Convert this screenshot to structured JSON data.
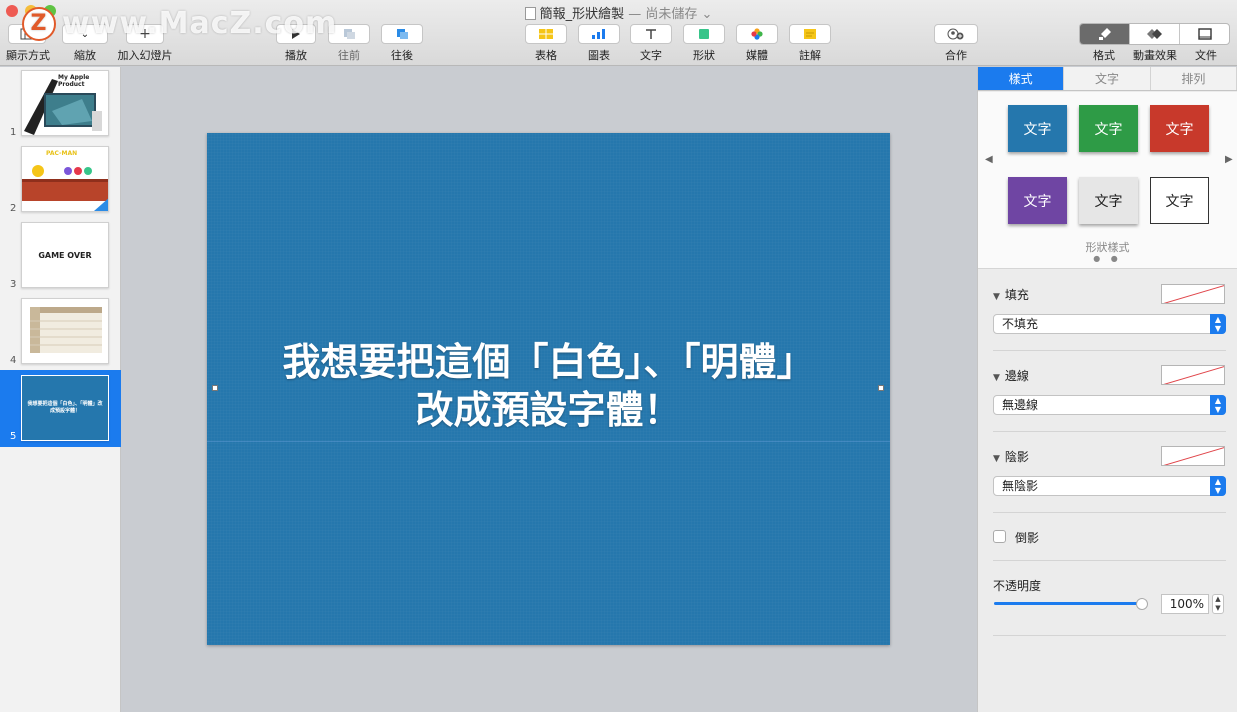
{
  "window": {
    "title": "簡報_形狀繪製",
    "title_separator": "—",
    "title_status": "尚未儲存",
    "watermark": "www.MacZ.com"
  },
  "toolbar": {
    "view_label": "顯示方式",
    "zoom_label": "縮放",
    "add_slide_label": "加入幻燈片",
    "play_label": "播放",
    "forward_label": "往前",
    "backward_label": "往後",
    "table_label": "表格",
    "chart_label": "圖表",
    "text_label": "文字",
    "shape_label": "形狀",
    "media_label": "媒體",
    "comment_label": "註解",
    "collaborate_label": "合作",
    "format_label": "格式",
    "animate_label": "動畫效果",
    "document_label": "文件"
  },
  "navigator": {
    "slides": [
      {
        "number": "1",
        "caption": "My Apple Product"
      },
      {
        "number": "2",
        "caption": "PAC-MAN"
      },
      {
        "number": "3",
        "caption": "GAME OVER"
      },
      {
        "number": "4",
        "caption": ""
      },
      {
        "number": "5",
        "caption": "我想要把這個「白色」、「明體」改成預設字體！"
      }
    ]
  },
  "slide": {
    "line1": "我想要把這個「白色」、「明體」",
    "line2": "改成預設字體！"
  },
  "inspector": {
    "tabs": [
      "樣式",
      "文字",
      "排列"
    ],
    "style_presets": [
      {
        "label": "文字",
        "bg": "#2577ad",
        "fg": "#ffffff"
      },
      {
        "label": "文字",
        "bg": "#2e9b46",
        "fg": "#ffffff"
      },
      {
        "label": "文字",
        "bg": "#c8392b",
        "fg": "#ffffff"
      },
      {
        "label": "文字",
        "bg": "#6f45a3",
        "fg": "#ffffff"
      },
      {
        "label": "文字",
        "bg": "#e6e6e6",
        "fg": "#222222"
      },
      {
        "label": "文字",
        "bg": "#ffffff",
        "fg": "#222222"
      }
    ],
    "styles_caption": "形狀樣式",
    "fill": {
      "title": "填充",
      "value": "不填充"
    },
    "border": {
      "title": "邊線",
      "value": "無邊線"
    },
    "shadow": {
      "title": "陰影",
      "value": "無陰影"
    },
    "reflection": {
      "title": "倒影"
    },
    "opacity": {
      "title": "不透明度",
      "value": "100%",
      "level": 1.0
    }
  },
  "colors": {
    "accent": "#1b7bee",
    "slide_bg": "#2577ad"
  }
}
